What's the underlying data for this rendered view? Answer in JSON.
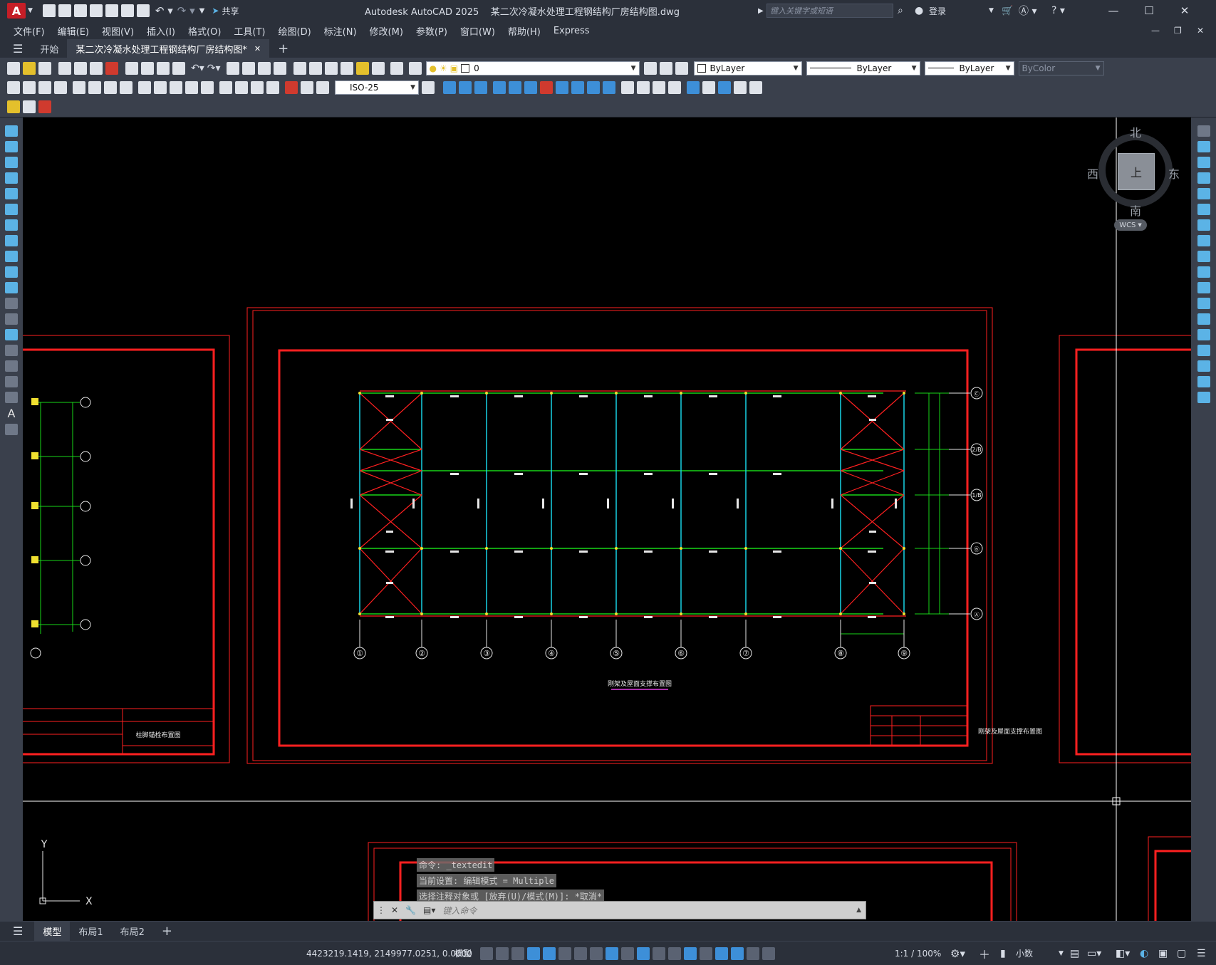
{
  "app": {
    "title": "Autodesk AutoCAD 2025    某二次冷凝水处理工程钢结构厂房结构图.dwg",
    "logo": "A",
    "share_label": "共享",
    "search_placeholder": "键入关键字或短语",
    "login_label": "登录"
  },
  "menu": [
    "文件(F)",
    "编辑(E)",
    "视图(V)",
    "插入(I)",
    "格式(O)",
    "工具(T)",
    "绘图(D)",
    "标注(N)",
    "修改(M)",
    "参数(P)",
    "窗口(W)",
    "帮助(H)",
    "Express"
  ],
  "tabs": {
    "start": "开始",
    "doc": "某二次冷凝水处理工程钢结构厂房结构图*",
    "add": "+"
  },
  "toolbar": {
    "layer_value": "0",
    "color_value": "ByLayer",
    "linetype_value": "ByLayer",
    "lineweight_value": "ByLayer",
    "plotstyle_value": "ByColor",
    "dimstyle_value": "ISO-25"
  },
  "viewcube": {
    "north": "北",
    "south": "南",
    "east": "东",
    "west": "西",
    "top": "上",
    "wcs": "WCS"
  },
  "drawing": {
    "main_title": "刚架及屋面支撑布置图",
    "left_title": "柱脚锚栓布置图",
    "right_titleblock": "刚架及屋面支撑布置图",
    "grid_numbers": [
      "①",
      "②",
      "③",
      "④",
      "⑤",
      "⑥",
      "⑦",
      "⑧",
      "⑨"
    ],
    "grid_letters": [
      "Ⓒ",
      "2/B",
      "1/B",
      "Ⓑ",
      "Ⓐ"
    ],
    "ucs_y": "Y",
    "ucs_x": "X"
  },
  "command": {
    "line1": "命令: _textedit",
    "line2": "当前设置: 编辑模式 = Multiple",
    "line3": "选择注释对象或 [放弃(U)/模式(M)]: *取消*",
    "placeholder": "键入命令"
  },
  "layouts": {
    "model": "模型",
    "layout1": "布局1",
    "layout2": "布局2",
    "add": "+"
  },
  "status": {
    "coords": "4423219.1419, 2149977.0251, 0.0000",
    "model": "模型",
    "scale": "1:1 / 100%",
    "units": "小数"
  }
}
